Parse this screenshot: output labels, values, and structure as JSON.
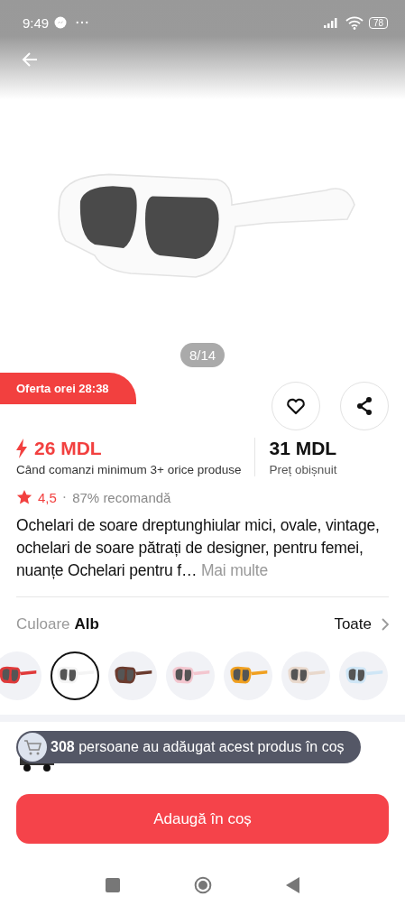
{
  "status_bar": {
    "time": "9:49",
    "battery": "78"
  },
  "gallery": {
    "counter": "8/14"
  },
  "offer": {
    "label": "Oferta orei 28:38"
  },
  "price": {
    "deal": "26 MDL",
    "deal_note": "Când comanzi minimum 3+ orice produse",
    "regular": "31 MDL",
    "regular_note": "Preț obișnuit"
  },
  "rating": {
    "score": "4,5",
    "separator": "·",
    "recommend": "87% recomandă"
  },
  "description": {
    "text": "Ochelari de soare dreptunghiular mici, ovale, vintage, ochelari de soare pătrați de designer, pentru femei, nuanțe Ochelari pentru f…",
    "more": "Mai multe"
  },
  "variant": {
    "label": "Culoare",
    "value": "Alb",
    "all": "Toate"
  },
  "swatches": [
    {
      "color": "#e03a3a",
      "selected": false
    },
    {
      "color": "#f4f4f4",
      "selected": true
    },
    {
      "color": "#6b3b2e",
      "selected": false
    },
    {
      "color": "#f3c6cf",
      "selected": false
    },
    {
      "color": "#f0a020",
      "selected": false
    },
    {
      "color": "#e8d8cc",
      "selected": false
    },
    {
      "color": "#cfe6f6",
      "selected": false
    }
  ],
  "toast": {
    "text": "**308** persoane au adăugat acest produs în coș"
  },
  "cta": {
    "label": "Adaugă în coș"
  }
}
